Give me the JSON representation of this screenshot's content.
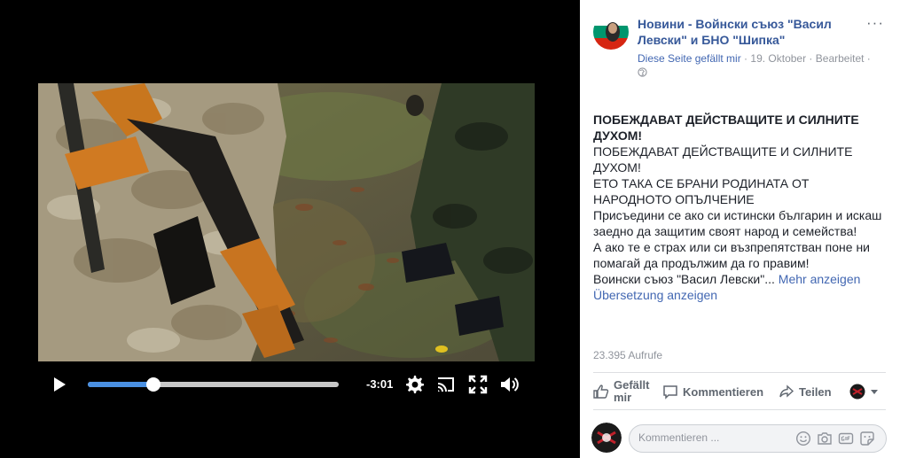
{
  "video": {
    "time_remaining": "-3:01",
    "progress": 0.26
  },
  "post": {
    "page_name": "Новини - Войнски съюз \"Васил Левски\" и БНО \"Шипка\"",
    "liked_label": "Diese Seite gefällt mir",
    "separator": " · ",
    "date": "19. Oktober",
    "edited": "Bearbeitet",
    "audience_separator": " · ",
    "title_bold": "ПОБЕЖДАВАТ ДЕЙСТВАЩИТЕ И СИЛНИТЕ ДУХОМ!",
    "line1": "ПОБЕЖДАВАТ ДЕЙСТВАЩИТЕ И СИЛНИТЕ ДУХОМ!",
    "line2": "ЕТО ТАКА СЕ БРАНИ РОДИНАТА ОТ НАРОДНОТО ОПЪЛЧЕНИЕ",
    "line3": "Присъедини се ако си истински българин и искаш заедно да защитим своят народ и семейства!",
    "line4": "А ако те е страх или си възпрепятстван поне ни помагай да продължим да го правим!",
    "line5": "Воински съюз \"Васил Левски\"...",
    "see_more": "Mehr anzeigen",
    "see_translation": "Übersetzung anzeigen",
    "views": "23.395 Aufrufe"
  },
  "actions": {
    "like_label": "Gefällt mir",
    "comment_label": "Kommentieren",
    "share_label": "Teilen"
  },
  "comment": {
    "placeholder": "Kommentieren ..."
  },
  "colors": {
    "link": "#365899",
    "seek": "#4a90e2"
  }
}
